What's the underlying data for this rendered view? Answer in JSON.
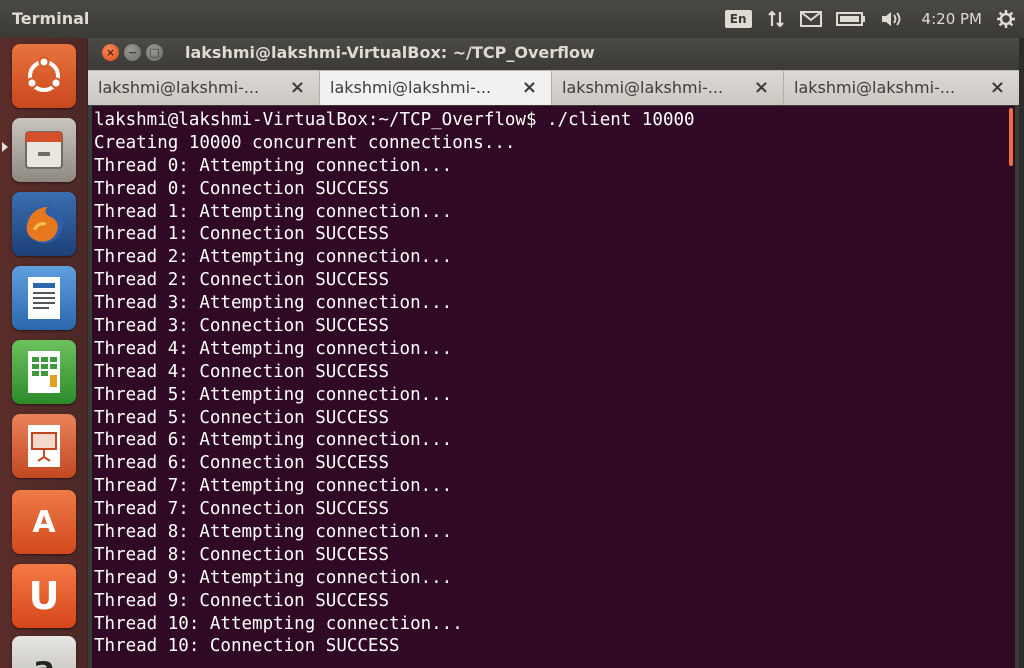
{
  "panel": {
    "app_title": "Terminal",
    "language": "En",
    "clock": "4:20 PM",
    "icons": [
      "network-arrows-icon",
      "mail-icon",
      "battery-icon",
      "volume-icon",
      "gear-icon"
    ]
  },
  "launcher": {
    "items": [
      {
        "name": "dash-home",
        "icon": "ubuntu-logo-icon",
        "color": "#de5a2a"
      },
      {
        "name": "files",
        "icon": "file-cabinet-icon",
        "color": "#a9a49b"
      },
      {
        "name": "firefox",
        "icon": "firefox-icon",
        "color": "#e0781e"
      },
      {
        "name": "writer",
        "icon": "document-icon",
        "color": "#3a7fc0"
      },
      {
        "name": "calc",
        "icon": "spreadsheet-icon",
        "color": "#3c9a3a"
      },
      {
        "name": "impress",
        "icon": "presentation-icon",
        "color": "#d5592a"
      },
      {
        "name": "software-center",
        "icon": "shopping-bag-icon",
        "color": "#e2592a",
        "glyph": "A"
      },
      {
        "name": "ubuntu-one",
        "icon": "ubuntu-one-icon",
        "color": "#e85b28",
        "glyph": "U"
      },
      {
        "name": "amazon",
        "icon": "amazon-icon",
        "color": "#c9c6c0",
        "glyph": "a"
      }
    ]
  },
  "window": {
    "title": "lakshmi@lakshmi-VirtualBox: ~/TCP_Overflow",
    "tabs": [
      {
        "label": "lakshmi@lakshmi-...",
        "active": false
      },
      {
        "label": "lakshmi@lakshmi-...",
        "active": true
      },
      {
        "label": "lakshmi@lakshmi-...",
        "active": false
      },
      {
        "label": "lakshmi@lakshmi-...",
        "active": false
      }
    ],
    "tab_close_glyph": "×"
  },
  "terminal": {
    "lines": [
      "lakshmi@lakshmi-VirtualBox:~/TCP_Overflow$ ./client 10000",
      "Creating 10000 concurrent connections...",
      "Thread 0: Attempting connection...",
      "Thread 0: Connection SUCCESS",
      "Thread 1: Attempting connection...",
      "Thread 1: Connection SUCCESS",
      "Thread 2: Attempting connection...",
      "Thread 2: Connection SUCCESS",
      "Thread 3: Attempting connection...",
      "Thread 3: Connection SUCCESS",
      "Thread 4: Attempting connection...",
      "Thread 4: Connection SUCCESS",
      "Thread 5: Attempting connection...",
      "Thread 5: Connection SUCCESS",
      "Thread 6: Attempting connection...",
      "Thread 6: Connection SUCCESS",
      "Thread 7: Attempting connection...",
      "Thread 7: Connection SUCCESS",
      "Thread 8: Attempting connection...",
      "Thread 8: Connection SUCCESS",
      "Thread 9: Attempting connection...",
      "Thread 9: Connection SUCCESS",
      "Thread 10: Attempting connection...",
      "Thread 10: Connection SUCCESS"
    ],
    "colors": {
      "background": "#300a24",
      "text": "#ffffff",
      "scrollbar": "#e86f3e"
    }
  }
}
